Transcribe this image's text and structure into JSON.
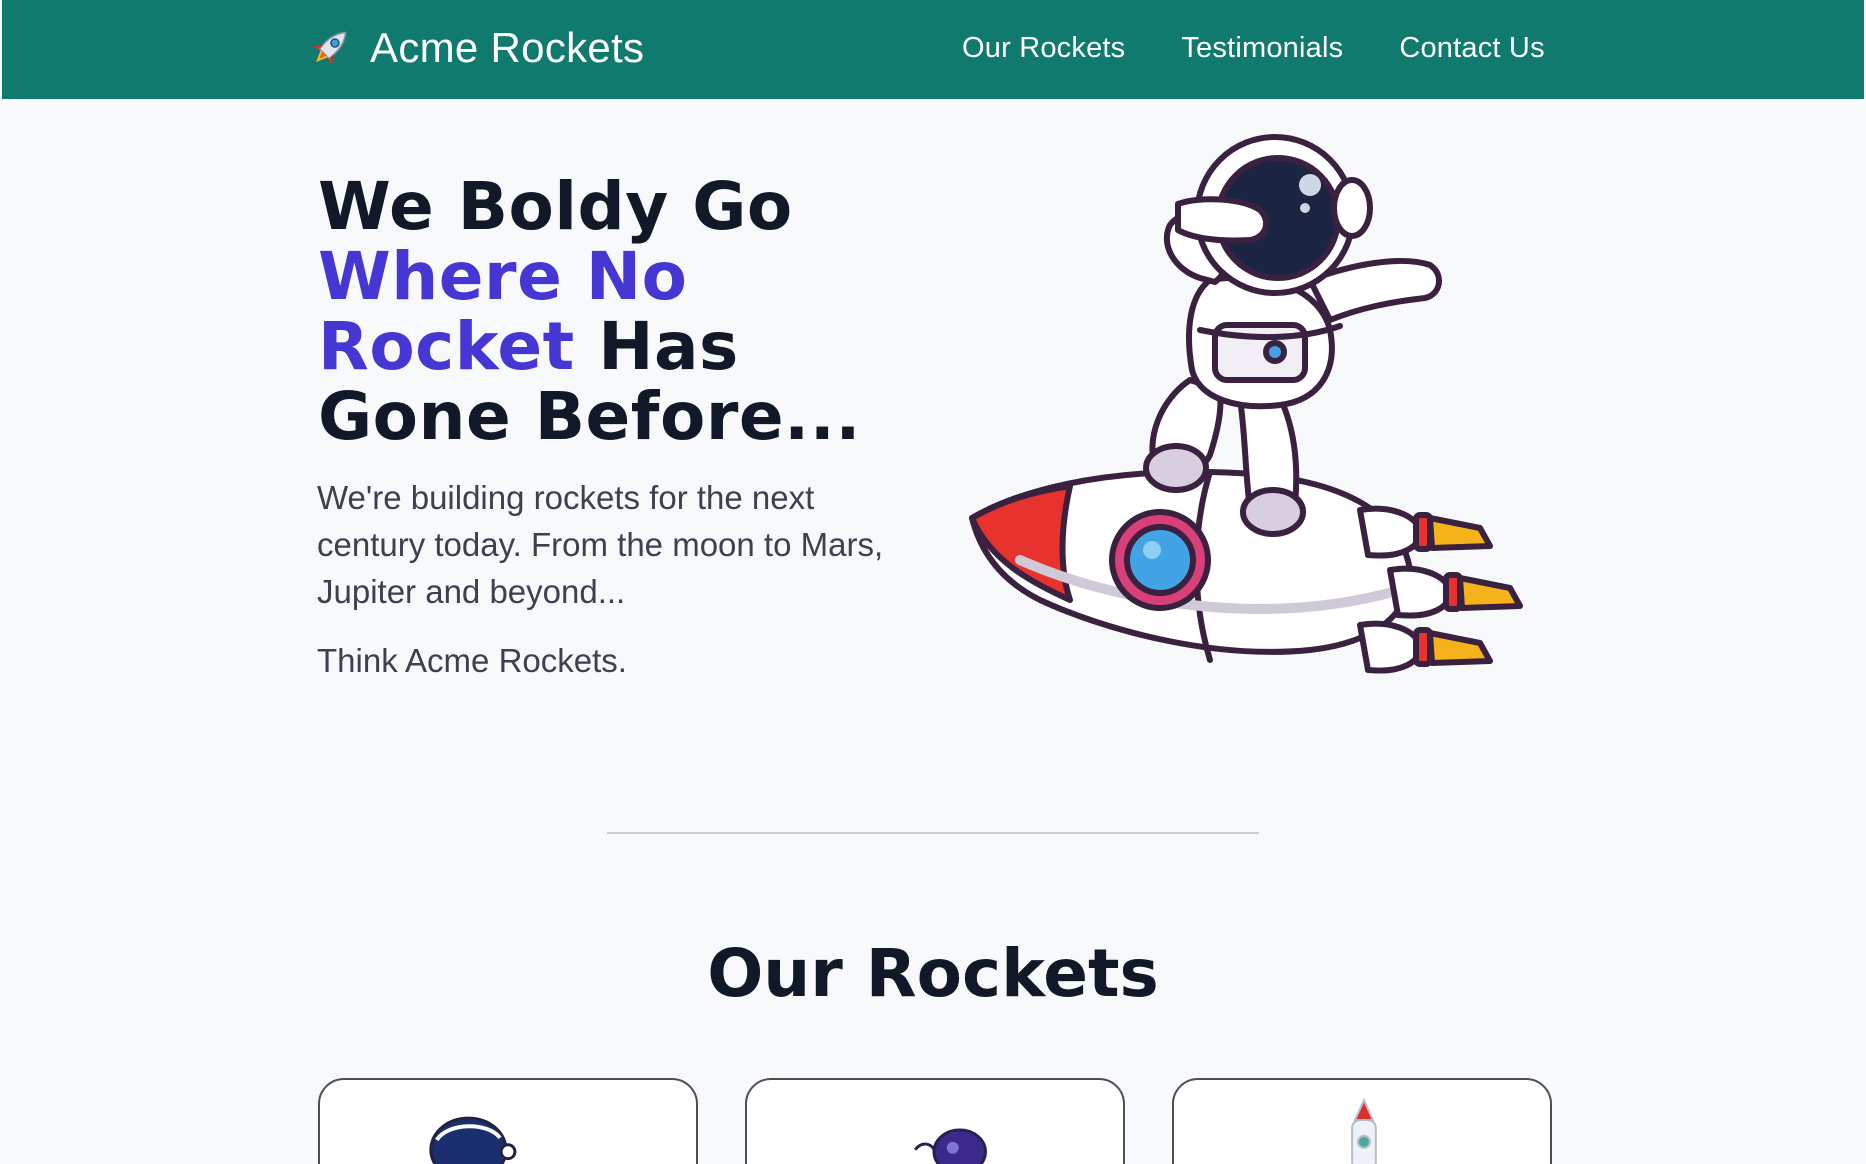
{
  "header": {
    "brand": "Acme Rockets",
    "nav": [
      "Our Rockets",
      "Testimonials",
      "Contact Us"
    ]
  },
  "hero": {
    "title_line1": "We Boldy Go",
    "title_accent1": "Where No",
    "title_accent2": "Rocket",
    "title_rest2": " Has",
    "title_line4": "Gone Before...",
    "subtitle": "We're building rockets for the next century today. From the moon to Mars, Jupiter and beyond...",
    "tagline": "Think Acme Rockets."
  },
  "section": {
    "title": "Our Rockets"
  },
  "cards": [
    {
      "icon": "astronaut-helmet-icon"
    },
    {
      "icon": "astronaut-icon"
    },
    {
      "icon": "rocket-icon"
    }
  ],
  "colors": {
    "header_bg": "#117a6e",
    "accent": "#4636d4",
    "text_dark": "#111827",
    "page_bg": "#f8f9fb"
  }
}
